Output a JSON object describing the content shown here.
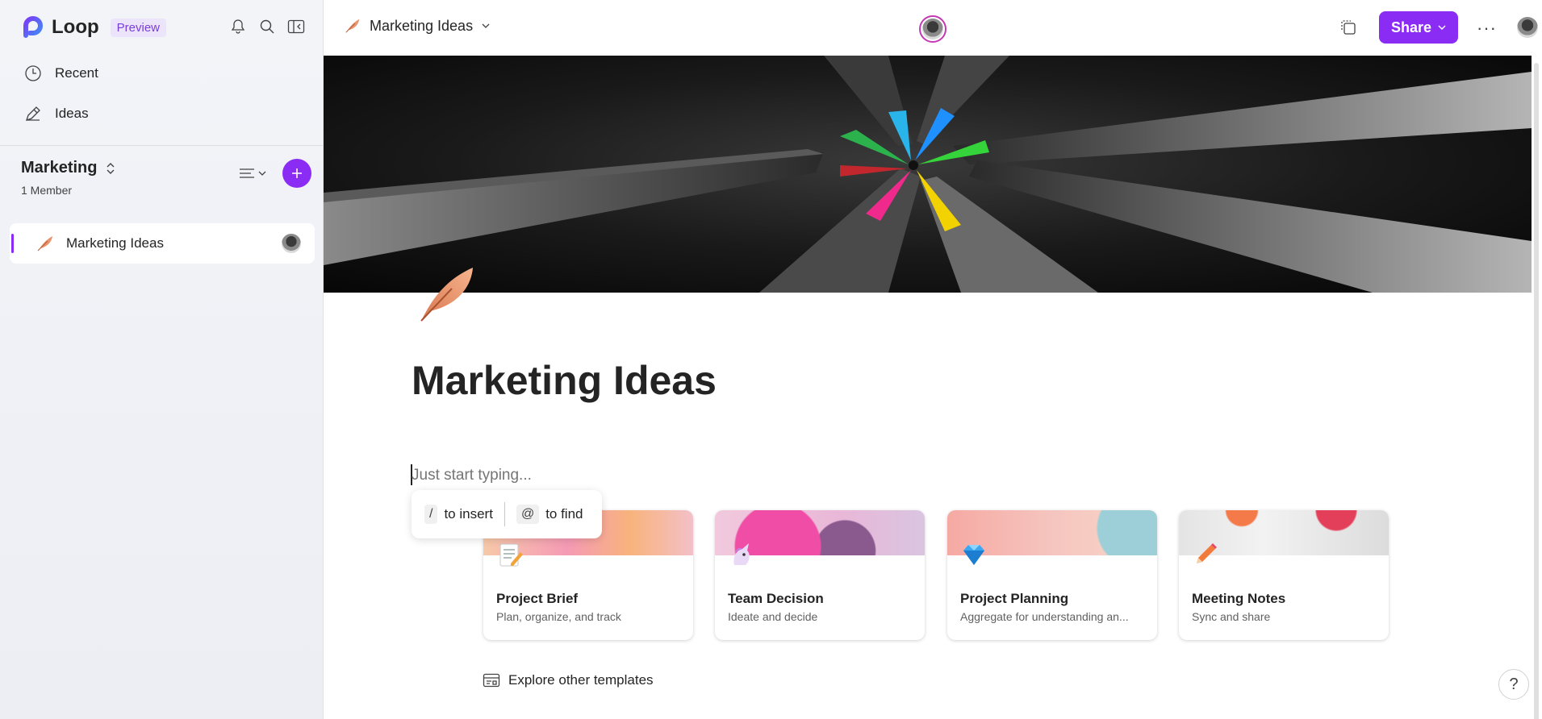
{
  "app": {
    "name": "Loop",
    "badge": "Preview"
  },
  "nav": [
    {
      "label": "Recent",
      "icon": "clock-icon"
    },
    {
      "label": "Ideas",
      "icon": "ideas-icon"
    }
  ],
  "workspace": {
    "name": "Marketing",
    "members": "1 Member"
  },
  "pages": [
    {
      "label": "Marketing Ideas",
      "icon": "feather-icon",
      "active": true
    }
  ],
  "header": {
    "doc_title": "Marketing Ideas",
    "share_label": "Share",
    "more": "···"
  },
  "document": {
    "title": "Marketing Ideas",
    "placeholder": "Just start typing...",
    "hint_insert_key": "/",
    "hint_insert": "to insert",
    "hint_find_key": "@",
    "hint_find": "to find"
  },
  "templates": [
    {
      "name": "Project Brief",
      "desc": "Plan, organize, and track",
      "icon": "memo-icon"
    },
    {
      "name": "Team Decision",
      "desc": "Ideate and decide",
      "icon": "unicorn-icon"
    },
    {
      "name": "Project Planning",
      "desc": "Aggregate for understanding an...",
      "icon": "gem-icon"
    },
    {
      "name": "Meeting Notes",
      "desc": "Sync and share",
      "icon": "pencil-icon"
    }
  ],
  "explore_label": "Explore other templates",
  "help": "?",
  "colors": {
    "accent": "#8b2cf5",
    "accent_ring": "#c239b3",
    "badge_bg": "#ece4fb"
  }
}
